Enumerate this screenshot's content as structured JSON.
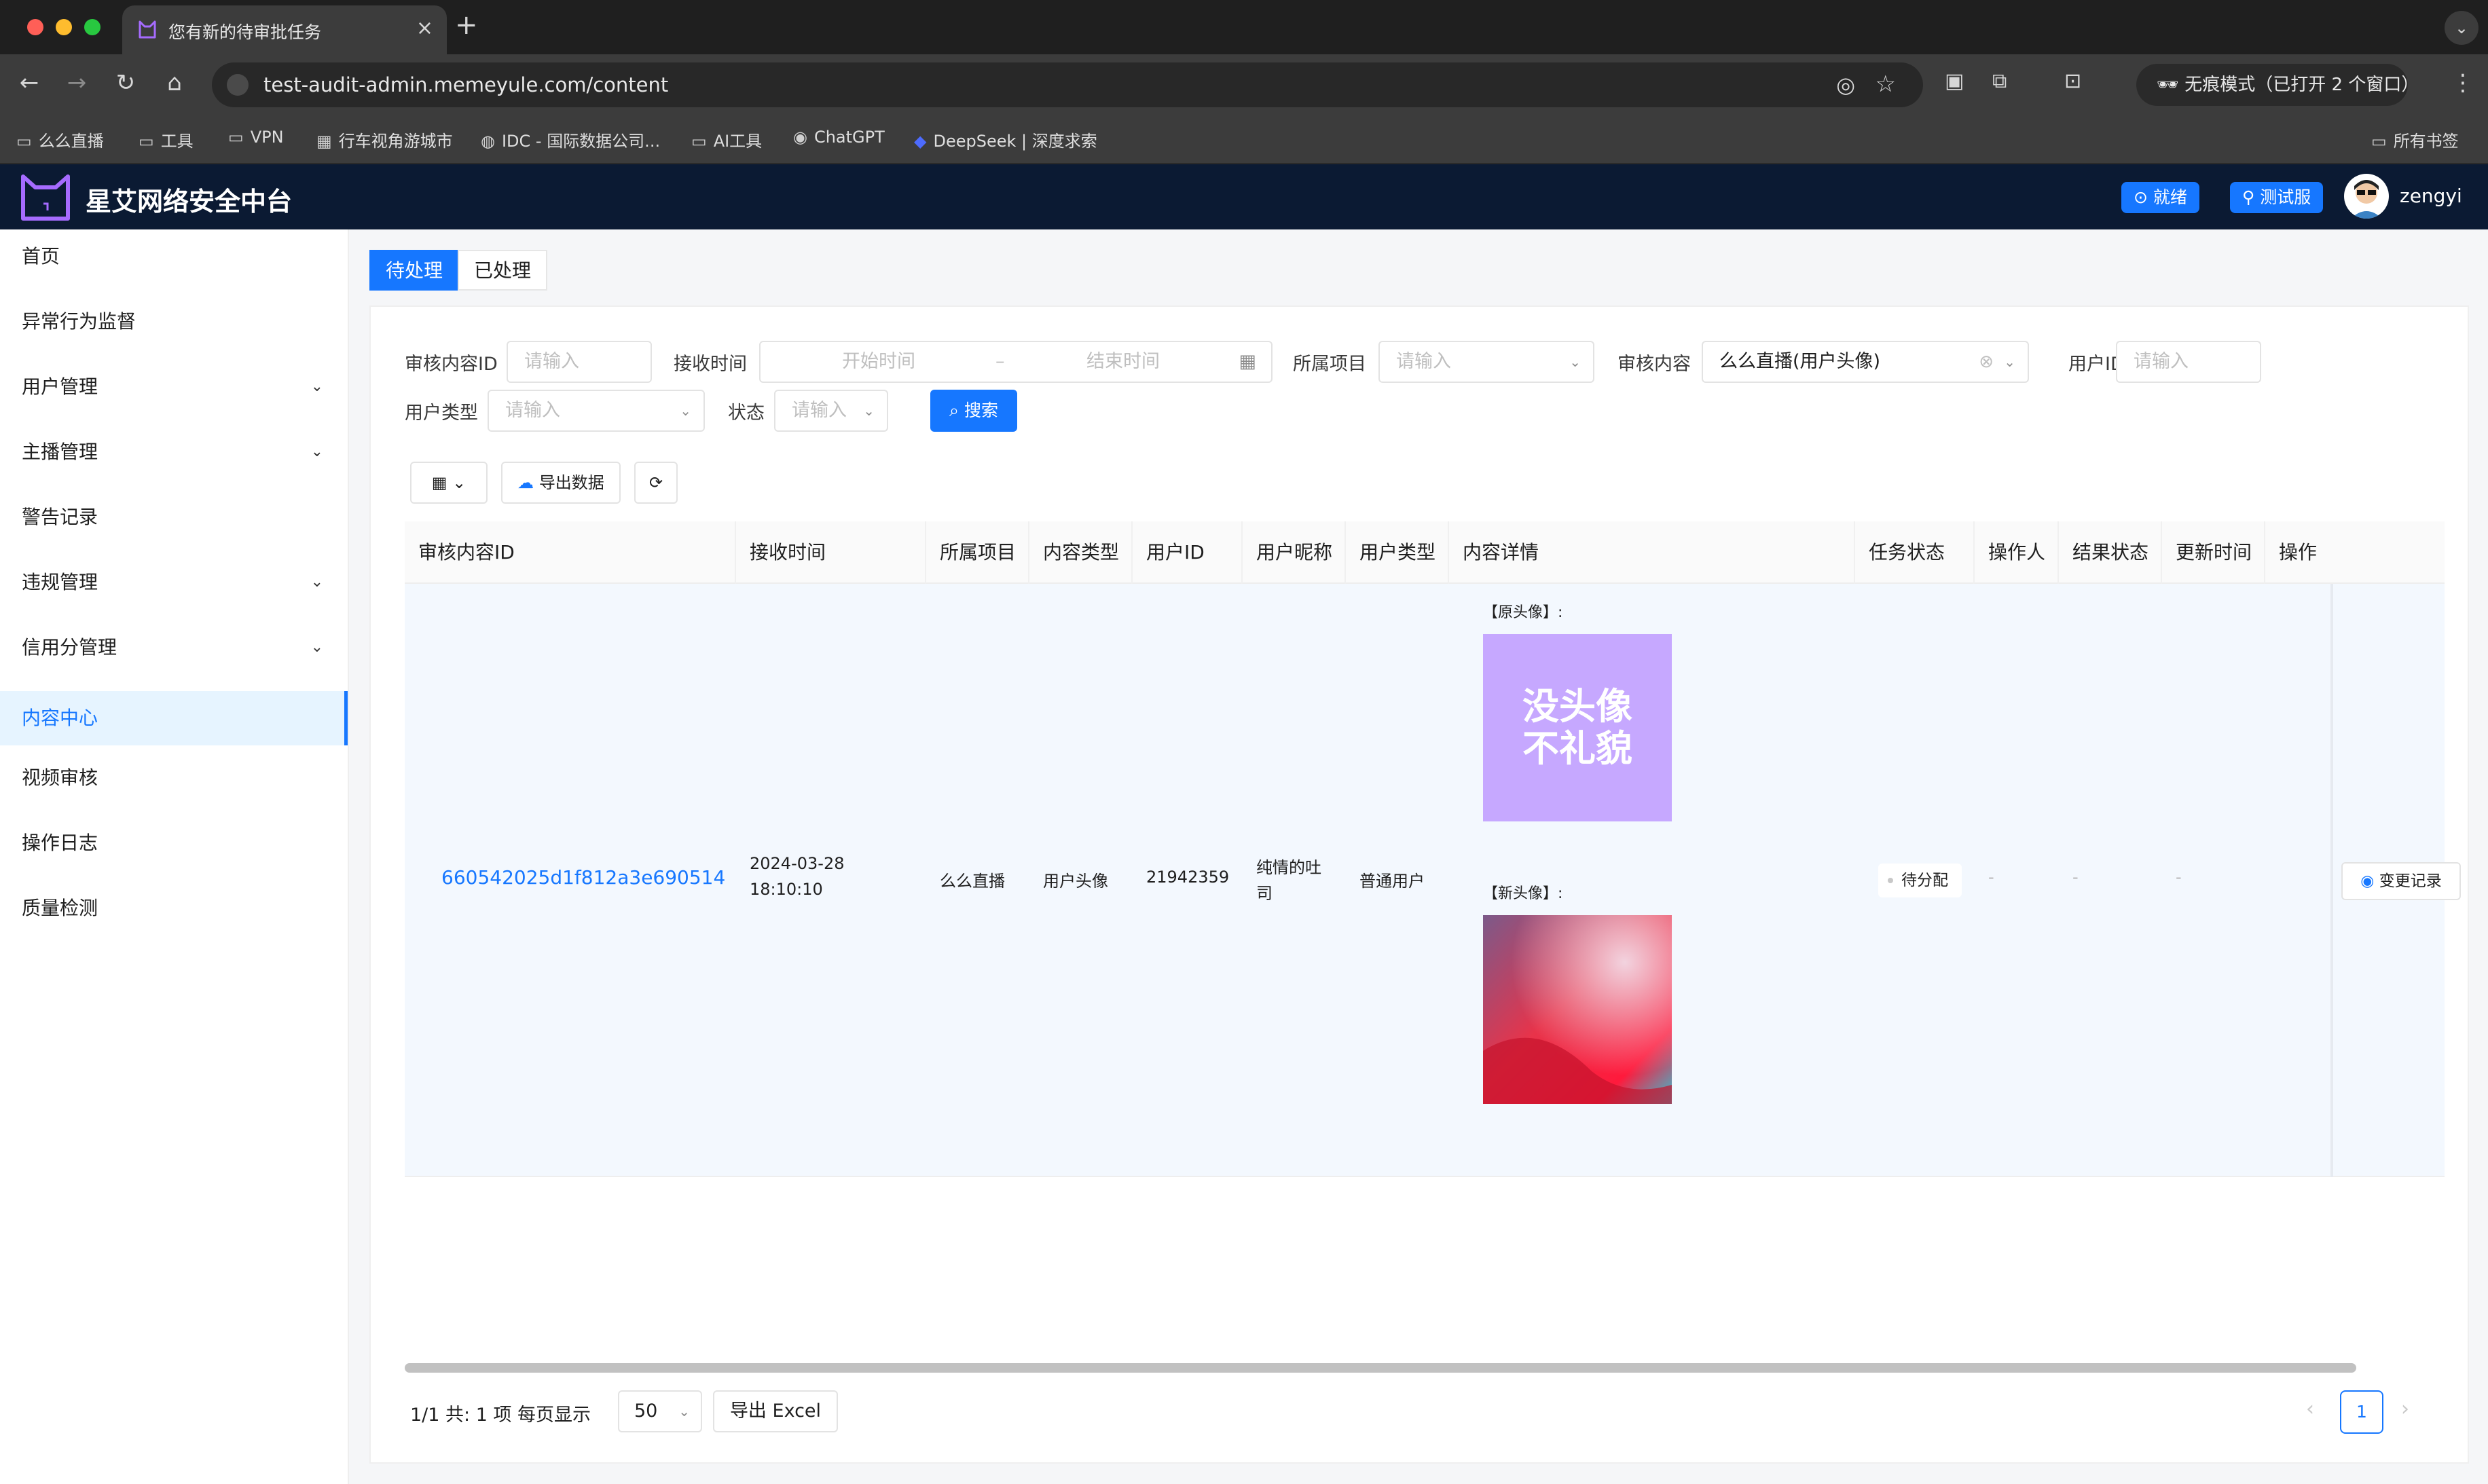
{
  "browser": {
    "tab_title": "您有新的待审批任务",
    "url": "test-audit-admin.memeyule.com/content",
    "incognito_label": "无痕模式（已打开 2 个窗口）",
    "bookmarks": [
      "么么直播",
      "工具",
      "VPN",
      "行车视角游城市",
      "IDC - 国际数据公司...",
      "AI工具",
      "ChatGPT",
      "DeepSeek | 深度求索"
    ],
    "all_bookmarks": "所有书签"
  },
  "app": {
    "title": "星艾网络安全中台",
    "status_btn": "就绪",
    "env_btn": "测试服",
    "username": "zengyi"
  },
  "sidebar": {
    "items": [
      {
        "label": "首页"
      },
      {
        "label": "异常行为监督"
      },
      {
        "label": "用户管理"
      },
      {
        "label": "主播管理"
      },
      {
        "label": "警告记录"
      },
      {
        "label": "违规管理"
      },
      {
        "label": "信用分管理"
      },
      {
        "label": "内容中心"
      },
      {
        "label": "视频审核"
      },
      {
        "label": "操作日志"
      },
      {
        "label": "质量检测"
      }
    ]
  },
  "tabs": {
    "pending": "待处理",
    "done": "已处理"
  },
  "filters": {
    "content_id_label": "审核内容ID",
    "content_id_placeholder": "请输入",
    "receive_time_label": "接收时间",
    "start_placeholder": "开始时间",
    "end_placeholder": "结束时间",
    "range_sep": "–",
    "project_label": "所属项目",
    "project_placeholder": "请输入",
    "content_label": "审核内容",
    "content_value": "么么直播(用户头像)",
    "user_id_label": "用户ID",
    "user_id_placeholder": "请输入",
    "user_type_label": "用户类型",
    "user_type_placeholder": "请输入",
    "status_label": "状态",
    "status_placeholder": "请输入",
    "search": "搜索"
  },
  "toolbar": {
    "export": "导出数据"
  },
  "table": {
    "headers": [
      "审核内容ID",
      "接收时间",
      "所属项目",
      "内容类型",
      "用户ID",
      "用户昵称",
      "用户类型",
      "内容详情",
      "任务状态",
      "操作人",
      "结果状态",
      "更新时间",
      "操作"
    ],
    "row": {
      "content_id": "660542025d1f812a3e690514",
      "receive_date": "2024-03-28",
      "receive_time": "18:10:10",
      "project": "么么直播",
      "content_type": "用户头像",
      "user_id": "21942359",
      "nickname_line1": "纯情的吐",
      "nickname_line2": "司",
      "user_type": "普通用户",
      "old_avatar_caption": "【原头像】:",
      "old_avatar_text_line1": "没头像",
      "old_avatar_text_line2": "不礼貌",
      "new_avatar_caption": "【新头像】:",
      "task_status": "待分配",
      "operator": "-",
      "result_status": "-",
      "update_time": "-",
      "action": "变更记录"
    }
  },
  "pagination": {
    "summary": "1/1 共: 1 项   每页显示",
    "page_size": "50",
    "export_excel": "导出 Excel",
    "current_page": "1"
  },
  "colors": {
    "primary": "#1677ff",
    "header_bg": "#0b1a33",
    "old_avatar_bg": "#c6a8ff"
  }
}
